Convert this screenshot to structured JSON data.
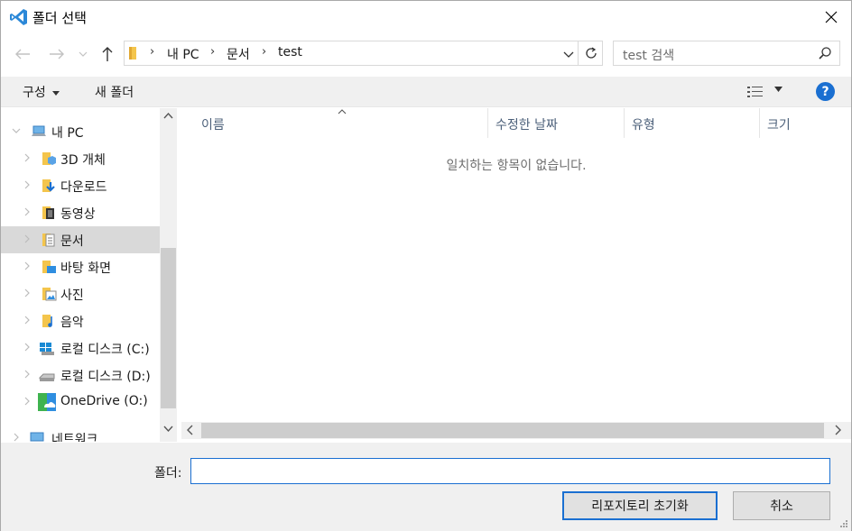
{
  "window": {
    "title": "폴더 선택",
    "accent_color": "#1a6fd1"
  },
  "address_bar": {
    "breadcrumbs": [
      "내 PC",
      "문서",
      "test"
    ]
  },
  "search": {
    "placeholder": "test 검색"
  },
  "toolbar": {
    "organize_label": "구성",
    "new_folder_label": "새 폴더",
    "help_label": "?"
  },
  "nav_pane": {
    "items": [
      {
        "label": "내 PC",
        "icon": "computer-icon"
      },
      {
        "label": "3D 개체",
        "icon": "3d-objects-icon"
      },
      {
        "label": "다운로드",
        "icon": "downloads-icon"
      },
      {
        "label": "동영상",
        "icon": "videos-icon"
      },
      {
        "label": "문서",
        "icon": "documents-icon",
        "selected": true
      },
      {
        "label": "바탕 화면",
        "icon": "desktop-icon"
      },
      {
        "label": "사진",
        "icon": "pictures-icon"
      },
      {
        "label": "음악",
        "icon": "music-icon"
      },
      {
        "label": "로컬 디스크 (C:)",
        "icon": "windows-drive-icon"
      },
      {
        "label": "로컬 디스크 (D:)",
        "icon": "drive-icon"
      },
      {
        "label": "OneDrive (O:)",
        "icon": "onedrive-drive-icon"
      },
      {
        "label": "네트워크",
        "icon": "network-icon"
      }
    ]
  },
  "file_list": {
    "columns": [
      "이름",
      "수정한 날짜",
      "유형",
      "크기"
    ],
    "empty_message": "일치하는 항목이 없습니다."
  },
  "footer": {
    "folder_label": "폴더:",
    "folder_value": "",
    "confirm_button": "리포지토리 초기화",
    "cancel_button": "취소"
  }
}
